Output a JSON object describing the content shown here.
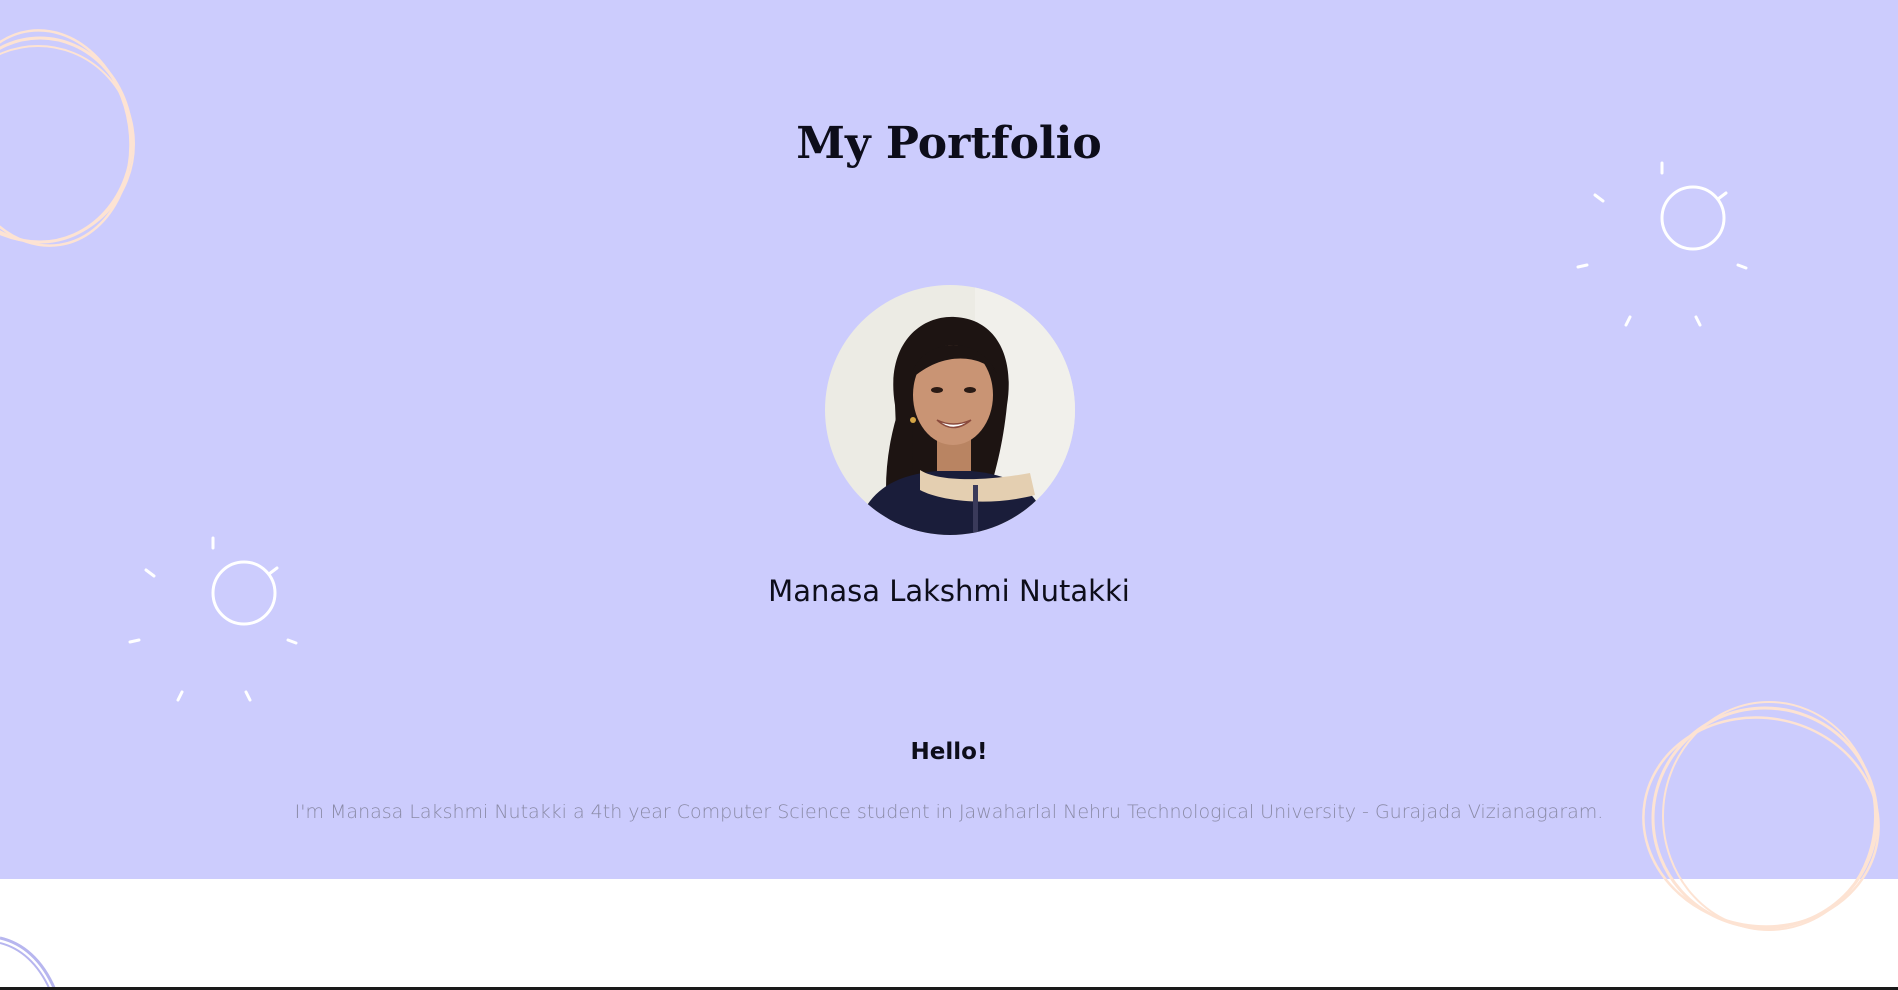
{
  "header": {
    "title": "My Portfolio"
  },
  "profile": {
    "name": "Manasa Lakshmi Nutakki"
  },
  "about": {
    "greeting": "Hello!",
    "bio": "I'm Manasa Lakshmi Nutakki a 4th year Computer Science student in Jawaharlal Nehru Technological University - Gurajada Vizianagaram."
  },
  "colors": {
    "hero_background": "#ccccfd",
    "ring_decoration": "#fde3d3",
    "sun_decoration": "#ffffff",
    "text_dark": "#0d0d1a",
    "text_muted": "#8a8aa6"
  },
  "icons": [
    "scribble-circle-icon",
    "sun-sketch-icon"
  ]
}
